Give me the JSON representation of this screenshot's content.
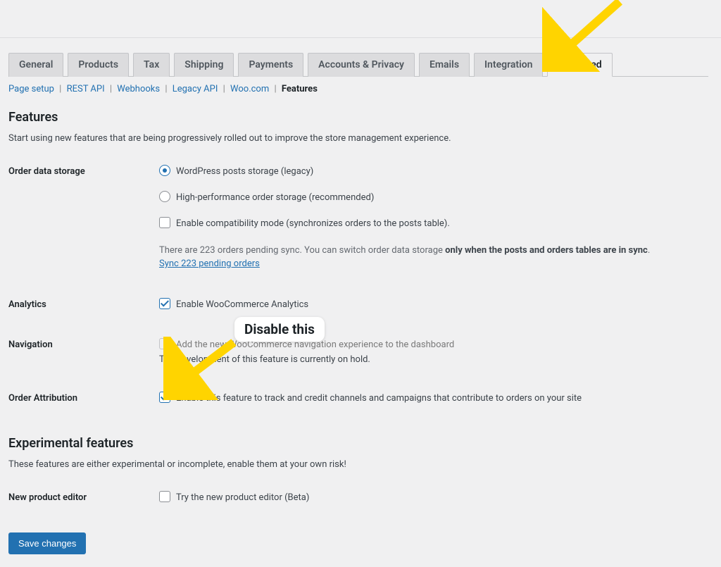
{
  "tabs": [
    "General",
    "Products",
    "Tax",
    "Shipping",
    "Payments",
    "Accounts & Privacy",
    "Emails",
    "Integration",
    "Advanced"
  ],
  "activeTab": "Advanced",
  "subtabs": [
    "Page setup",
    "REST API",
    "Webhooks",
    "Legacy API",
    "Woo.com",
    "Features"
  ],
  "activeSubtab": "Features",
  "featuresHeading": "Features",
  "featuresDesc": "Start using new features that are being progressively rolled out to improve the store management experience.",
  "orderStorage": {
    "label": "Order data storage",
    "opt1": "WordPress posts storage (legacy)",
    "opt2": "High-performance order storage (recommended)",
    "compat": "Enable compatibility mode (synchronizes orders to the posts table).",
    "metaPre": "There are 223 orders pending sync. You can switch order data storage ",
    "metaBold": "only when the posts and orders tables are in sync",
    "metaPost": ".",
    "syncLink": "Sync 223 pending orders"
  },
  "analytics": {
    "label": "Analytics",
    "txt": "Enable WooCommerce Analytics"
  },
  "navigation": {
    "label": "Navigation",
    "txt": "Add the new WooCommerce navigation experience to the dashboard",
    "note": "The development of this feature is currently on hold."
  },
  "attribution": {
    "label": "Order Attribution",
    "txt": "Enable this feature to track and credit channels and campaigns that contribute to orders on your site"
  },
  "experimentalHeading": "Experimental features",
  "experimentalDesc": "These features are either experimental or incomplete, enable them at your own risk!",
  "productEditor": {
    "label": "New product editor",
    "txt": "Try the new product editor (Beta)"
  },
  "saveButton": "Save changes",
  "callout": "Disable this"
}
